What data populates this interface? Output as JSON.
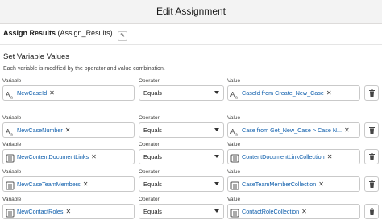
{
  "header": {
    "title": "Edit Assignment"
  },
  "element": {
    "label": "Assign Results",
    "api_name": "(Assign_Results)"
  },
  "section": {
    "title": "Set Variable Values",
    "description": "Each variable is modified by the operator and value combination."
  },
  "columns": {
    "variable": "Variable",
    "operator": "Operator",
    "value": "Value"
  },
  "rows": [
    {
      "variable": "NewCaseId",
      "variable_icon": "text-type-icon",
      "operator": "Equals",
      "value": "CaseId from Create_New_Case",
      "value_icon": "text-type-icon"
    },
    {
      "variable": "NewCaseNumber",
      "variable_icon": "text-type-icon",
      "operator": "Equals",
      "value": "Case from Get_New_Case > Case N...",
      "value_icon": "text-type-icon"
    },
    {
      "variable": "NewContentDocumentLinks",
      "variable_icon": "collection-icon",
      "operator": "Equals",
      "value": "ContentDocumentLinkCollection",
      "value_icon": "collection-icon"
    },
    {
      "variable": "NewCaseTeamMembers",
      "variable_icon": "collection-icon",
      "operator": "Equals",
      "value": "CaseTeamMemberCollection",
      "value_icon": "collection-icon"
    },
    {
      "variable": "NewContactRoles",
      "variable_icon": "collection-icon",
      "operator": "Equals",
      "value": "ContactRoleCollection",
      "value_icon": "collection-icon"
    }
  ],
  "colors": {
    "link": "#0b5cab",
    "border": "#c9c9c9",
    "header_bg": "#f3f3f3"
  }
}
